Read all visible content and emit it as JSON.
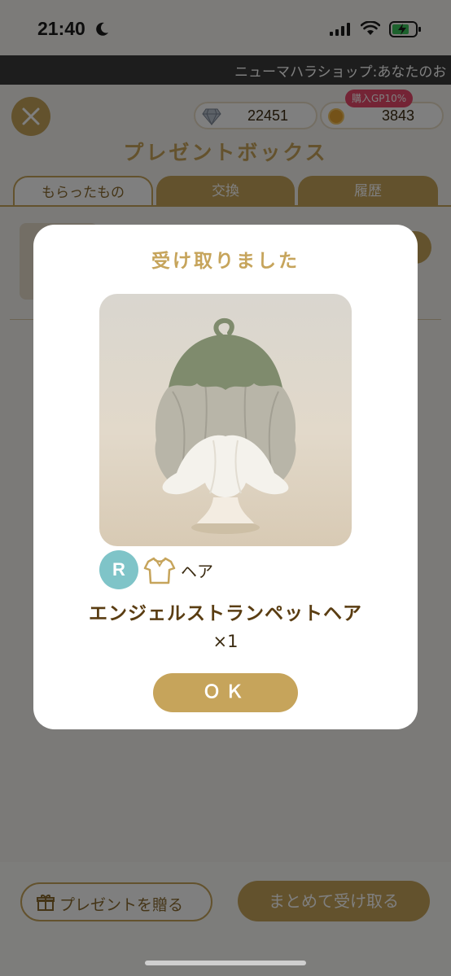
{
  "status_bar": {
    "time": "21:40"
  },
  "marquee": {
    "text": "ニューマハラショップ:あなたのお"
  },
  "header": {
    "gems": "22451",
    "coins": "3843",
    "gp_badge": "購入GP10%",
    "title": "プレゼントボックス"
  },
  "tabs": [
    {
      "label": "もらったもの"
    },
    {
      "label": "交換"
    },
    {
      "label": "履歴"
    }
  ],
  "footer": {
    "send_gift_label": "プレゼントを贈る",
    "receive_all_label": "まとめて受け取る"
  },
  "modal": {
    "title": "受け取りました",
    "rarity": "R",
    "category": "ヘア",
    "item_name": "エンジェルストランペットヘア",
    "quantity": "×1",
    "ok_label": "ＯＫ"
  },
  "colors": {
    "accent_gold": "#c6a45b",
    "rarity_r": "#7fc4c8",
    "badge_pink": "#e8486b"
  },
  "icons": [
    "moon-icon",
    "signal-icon",
    "wifi-icon",
    "battery-icon",
    "close-icon",
    "gem-icon",
    "coin-icon",
    "gift-icon",
    "shirt-icon"
  ]
}
